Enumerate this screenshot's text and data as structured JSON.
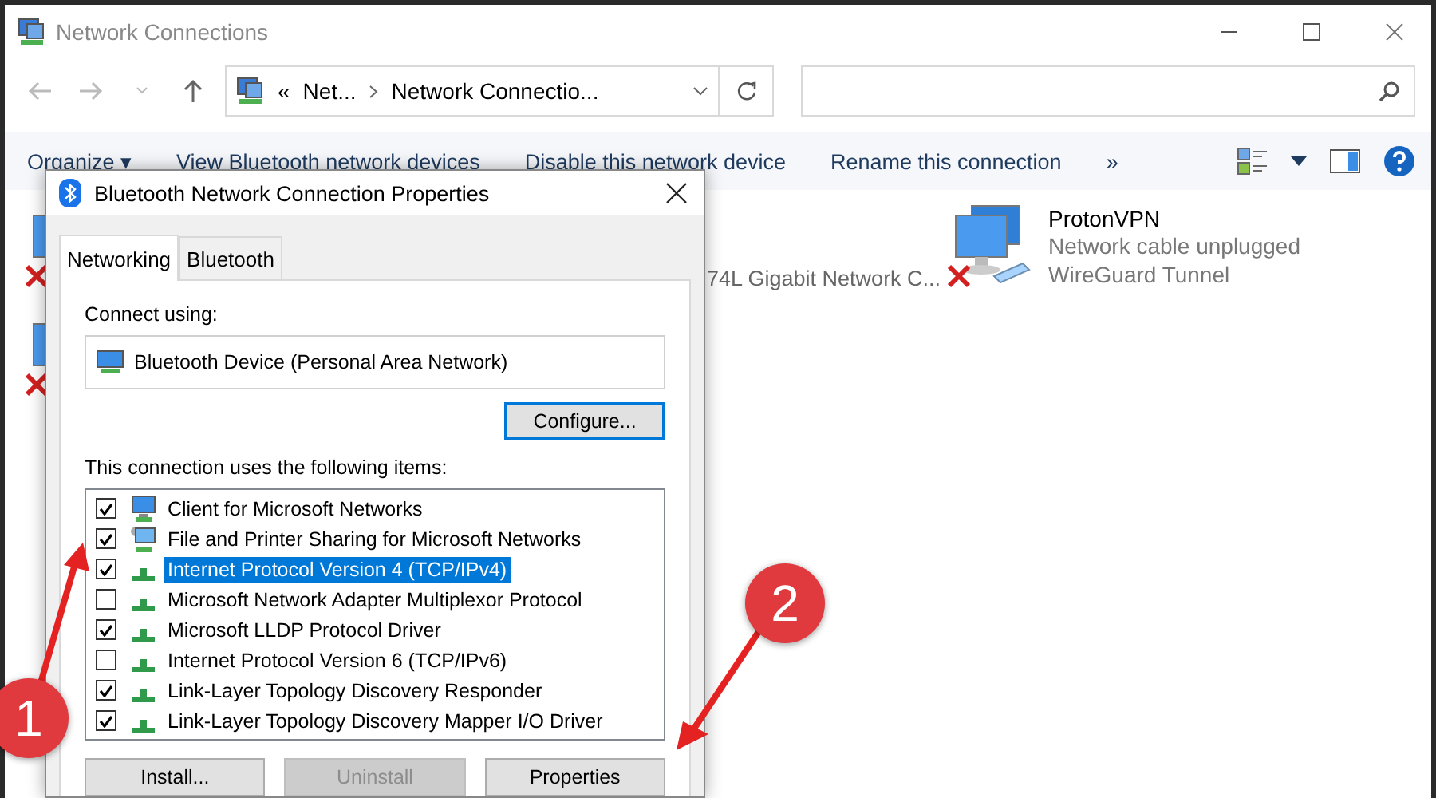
{
  "window": {
    "title": "Network Connections"
  },
  "address": {
    "overflow": "«",
    "parts": [
      "Net...",
      "Network Connectio..."
    ]
  },
  "command_bar": [
    "Organize ▾",
    "View Bluetooth network devices",
    "Disable this network device",
    "Rename this connection",
    "»"
  ],
  "connections": [
    {
      "disconnected": true
    },
    {
      "device": "74L Gigabit Network C..."
    },
    {
      "name": "ProtonVPN",
      "status": "Network cable unplugged",
      "device": "WireGuard Tunnel",
      "disconnected": true
    },
    {
      "disconnected": true
    }
  ],
  "dialog": {
    "title": "Bluetooth Network Connection Properties",
    "tabs": [
      {
        "label": "Networking",
        "selected": true
      },
      {
        "label": "Bluetooth",
        "selected": false
      }
    ],
    "connect_label": "Connect using:",
    "adapter": "Bluetooth Device (Personal Area Network)",
    "configure_button": "Configure...",
    "items_label": "This connection uses the following items:",
    "items": [
      {
        "label": "Client for Microsoft Networks",
        "kind": "client",
        "checked": true,
        "selected": false
      },
      {
        "label": "File and Printer Sharing for Microsoft Networks",
        "kind": "service",
        "checked": true,
        "selected": false
      },
      {
        "label": "Internet Protocol Version 4 (TCP/IPv4)",
        "kind": "protocol",
        "checked": true,
        "selected": true
      },
      {
        "label": "Microsoft Network Adapter Multiplexor Protocol",
        "kind": "protocol",
        "checked": false,
        "selected": false
      },
      {
        "label": "Microsoft LLDP Protocol Driver",
        "kind": "protocol",
        "checked": true,
        "selected": false
      },
      {
        "label": "Internet Protocol Version 6 (TCP/IPv6)",
        "kind": "protocol",
        "checked": false,
        "selected": false
      },
      {
        "label": "Link-Layer Topology Discovery Responder",
        "kind": "protocol",
        "checked": true,
        "selected": false
      },
      {
        "label": "Link-Layer Topology Discovery Mapper I/O Driver",
        "kind": "protocol",
        "checked": true,
        "selected": false
      }
    ],
    "buttons": [
      {
        "label": "Install...",
        "disabled": false
      },
      {
        "label": "Uninstall",
        "disabled": true
      },
      {
        "label": "Properties",
        "disabled": false
      }
    ]
  },
  "annotations": [
    {
      "label": "1"
    },
    {
      "label": "2"
    }
  ]
}
